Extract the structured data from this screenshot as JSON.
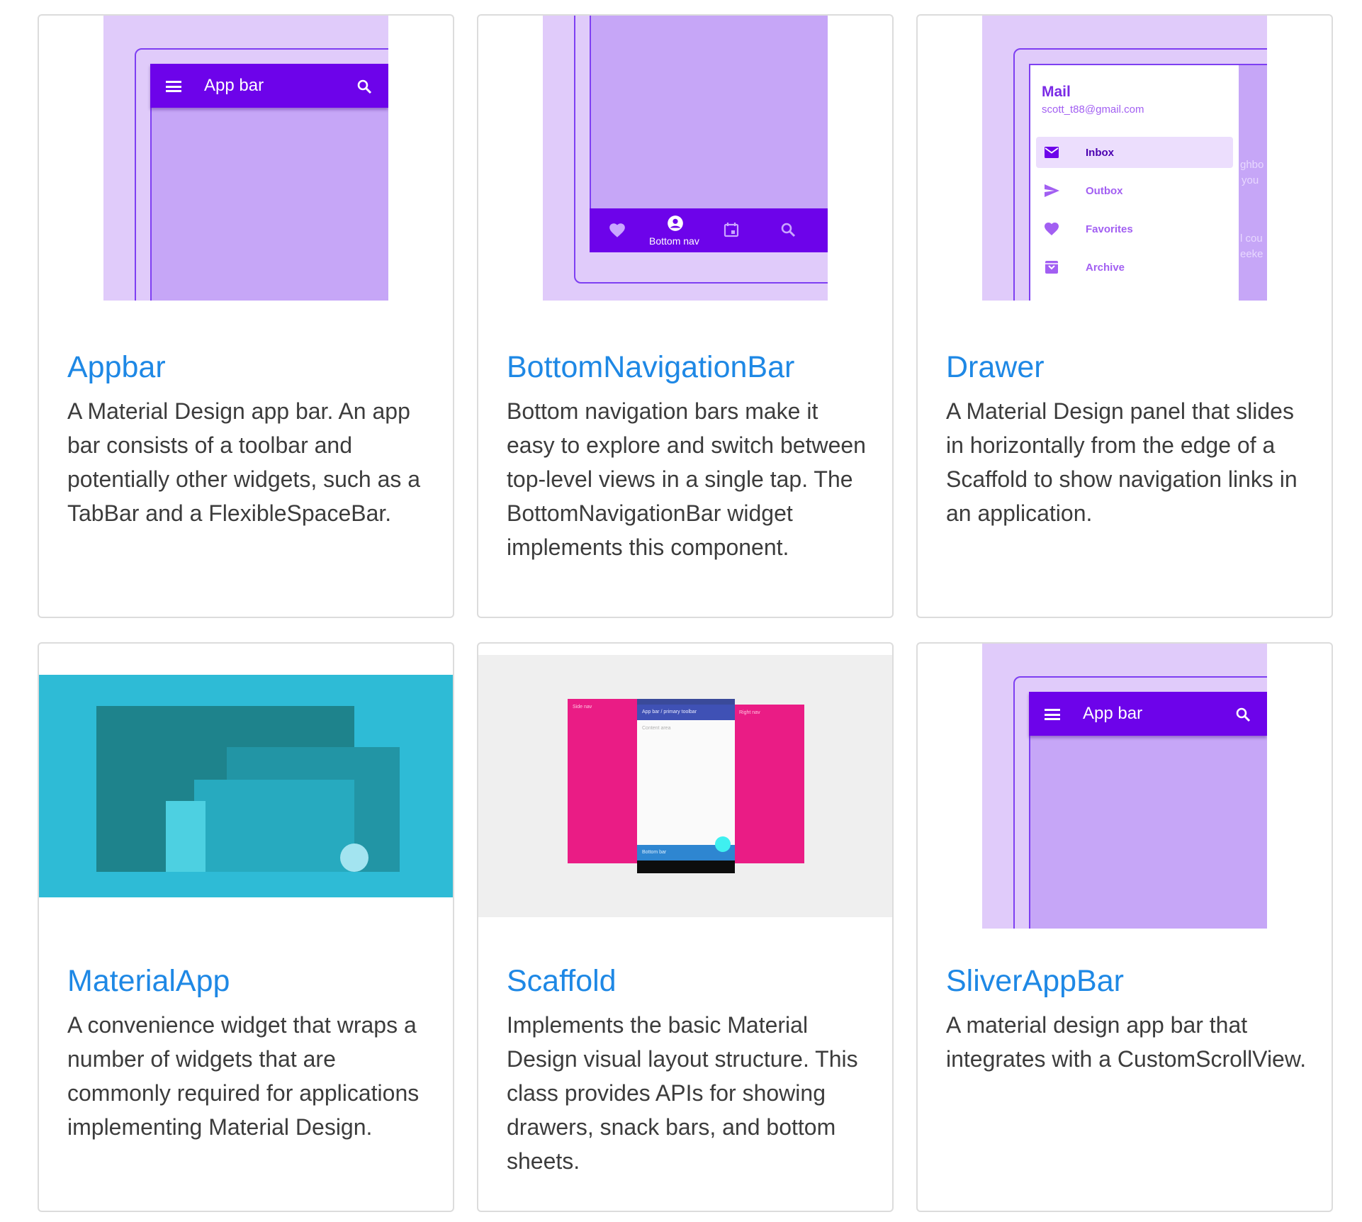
{
  "cards": [
    {
      "title": "Appbar",
      "description": "A Material Design app bar. An app bar consists of a toolbar and potentially other widgets, such as a TabBar and a FlexibleSpaceBar.",
      "thumb": {
        "app_bar_label": "App bar",
        "icons": [
          "menu-icon",
          "search-icon"
        ]
      }
    },
    {
      "title": "BottomNavigationBar",
      "description": "Bottom navigation bars make it easy to explore and switch between top-level views in a single tap. The BottomNavigationBar widget implements this component.",
      "thumb": {
        "nav_label": "Bottom nav",
        "icons": [
          "heart-icon",
          "account-icon",
          "calendar-icon",
          "search-icon"
        ]
      }
    },
    {
      "title": "Drawer",
      "description": "A Material Design panel that slides in horizontally from the edge of a Scaffold to show navigation links in an application.",
      "thumb": {
        "account_name": "Mail",
        "account_email": "scott_t88@gmail.com",
        "items": [
          {
            "label": "Inbox",
            "icon": "mail-icon",
            "selected": true
          },
          {
            "label": "Outbox",
            "icon": "send-icon",
            "selected": false
          },
          {
            "label": "Favorites",
            "icon": "heart-icon",
            "selected": false
          },
          {
            "label": "Archive",
            "icon": "archive-icon",
            "selected": false
          }
        ],
        "peek_text": [
          "ghbo",
          "you",
          "l cou",
          "eeke"
        ]
      }
    },
    {
      "title": "MaterialApp",
      "description": "A convenience widget that wraps a number of widgets that are commonly required for applications implementing Material Design.",
      "thumb": {
        "colors": {
          "bg": "#2ebbd6",
          "dark": "#1e838c",
          "mid": "#2295a5",
          "light": "#27aabf",
          "pale": "#4dd0e1",
          "circle": "#a3e4f0"
        }
      }
    },
    {
      "title": "Scaffold",
      "description": "Implements the basic Material Design visual layout structure. This class provides APIs for showing drawers, snack bars, and bottom sheets.",
      "thumb": {
        "side_nav_label": "Side nav",
        "toolbar_label": "App bar / primary toolbar",
        "content_label": "Content area",
        "right_nav_label": "Right nav",
        "bottom_bar_label": "Bottom bar"
      }
    },
    {
      "title": "SliverAppBar",
      "description": "A material design app bar that integrates with a CustomScrollView.",
      "thumb": {
        "app_bar_label": "App bar",
        "icons": [
          "menu-icon",
          "search-icon"
        ]
      }
    }
  ],
  "colors": {
    "title": "#1e88e5",
    "text": "#3c3c3c",
    "purple": "#6d03ea",
    "pink": "#ea1c85",
    "border": "#dcdcdc"
  }
}
